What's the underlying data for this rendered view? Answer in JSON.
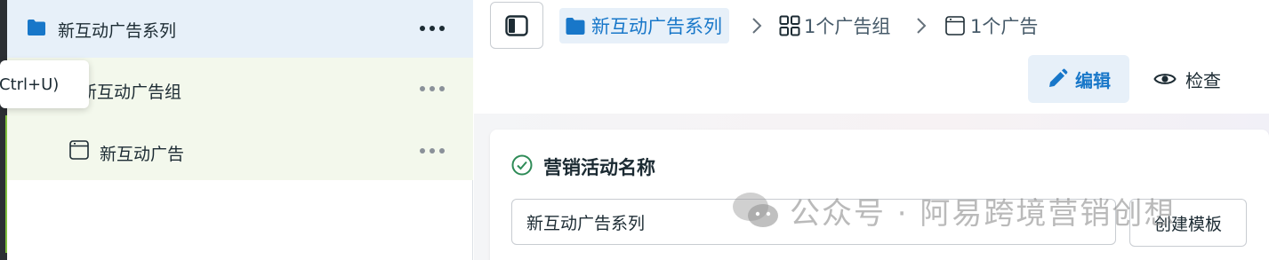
{
  "sidebar": {
    "campaign_label": "新互动广告系列",
    "adset_label": "新互动广告组",
    "ad_label": "新互动广告",
    "tooltip_text": "(Ctrl+U)"
  },
  "breadcrumb": {
    "campaign": "新互动广告系列",
    "adset": "1个广告组",
    "ad": "1个广告"
  },
  "toolbar": {
    "edit_label": "编辑",
    "inspect_label": "检查"
  },
  "card": {
    "title": "营销活动名称",
    "name_value": "新互动广告系列",
    "template_button": "创建模板"
  },
  "watermark": {
    "text": "公众号 · 阿易跨境营销创想"
  },
  "colors": {
    "accent": "#1877c9",
    "selected_bg": "#e7f0f9",
    "child_bg": "#f3f8ec",
    "edge_green": "#7fbf3f",
    "check_green": "#2e8b57"
  },
  "icons": {
    "campaign": "folder-icon",
    "adset": "grid-icon",
    "ad": "window-icon",
    "more": "more-horizontal-icon",
    "edit": "pencil-icon",
    "inspect": "eye-icon",
    "toggle": "sidebar-toggle-icon",
    "status": "check-circle-icon",
    "separator": "chevron-right-icon"
  }
}
